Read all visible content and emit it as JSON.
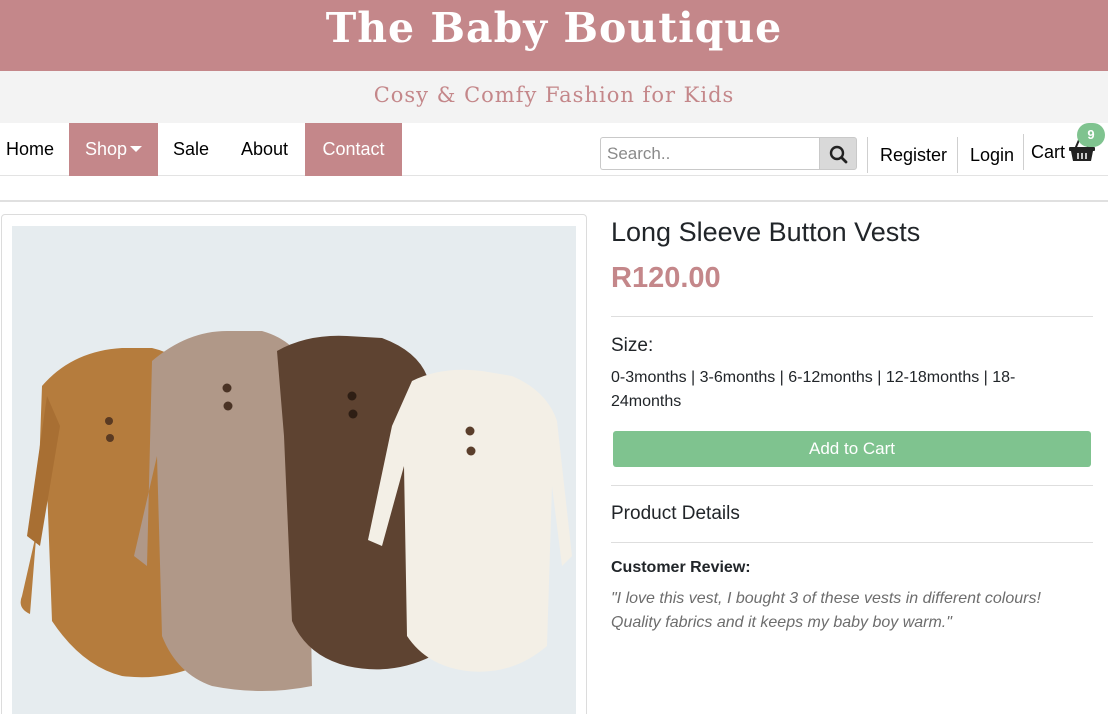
{
  "brand": {
    "title": "The Baby Boutique",
    "tagline": "Cosy & Comfy Fashion for Kids",
    "accent_color": "#c4878a",
    "button_color": "#7fc38f"
  },
  "nav": {
    "home": "Home",
    "shop": "Shop",
    "sale": "Sale",
    "about": "About",
    "contact": "Contact"
  },
  "search": {
    "placeholder": "Search..",
    "icon": "search-icon"
  },
  "account": {
    "register": "Register",
    "login": "Login",
    "cart_label": "Cart",
    "cart_count": "9",
    "cart_icon": "shopping-basket-icon"
  },
  "product": {
    "title": "Long Sleeve Button Vests",
    "price": "R120.00",
    "size_label": "Size:",
    "size_options": "0-3months | 3-6months | 6-12months | 12-18months | 18-24months",
    "add_to_cart": "Add to Cart",
    "details_title": "Product Details",
    "review_label": "Customer Review:",
    "review_text": "\"I love this vest, I bought 3 of these vests in different colours! Quality fabrics and it keeps my baby boy warm.\""
  }
}
